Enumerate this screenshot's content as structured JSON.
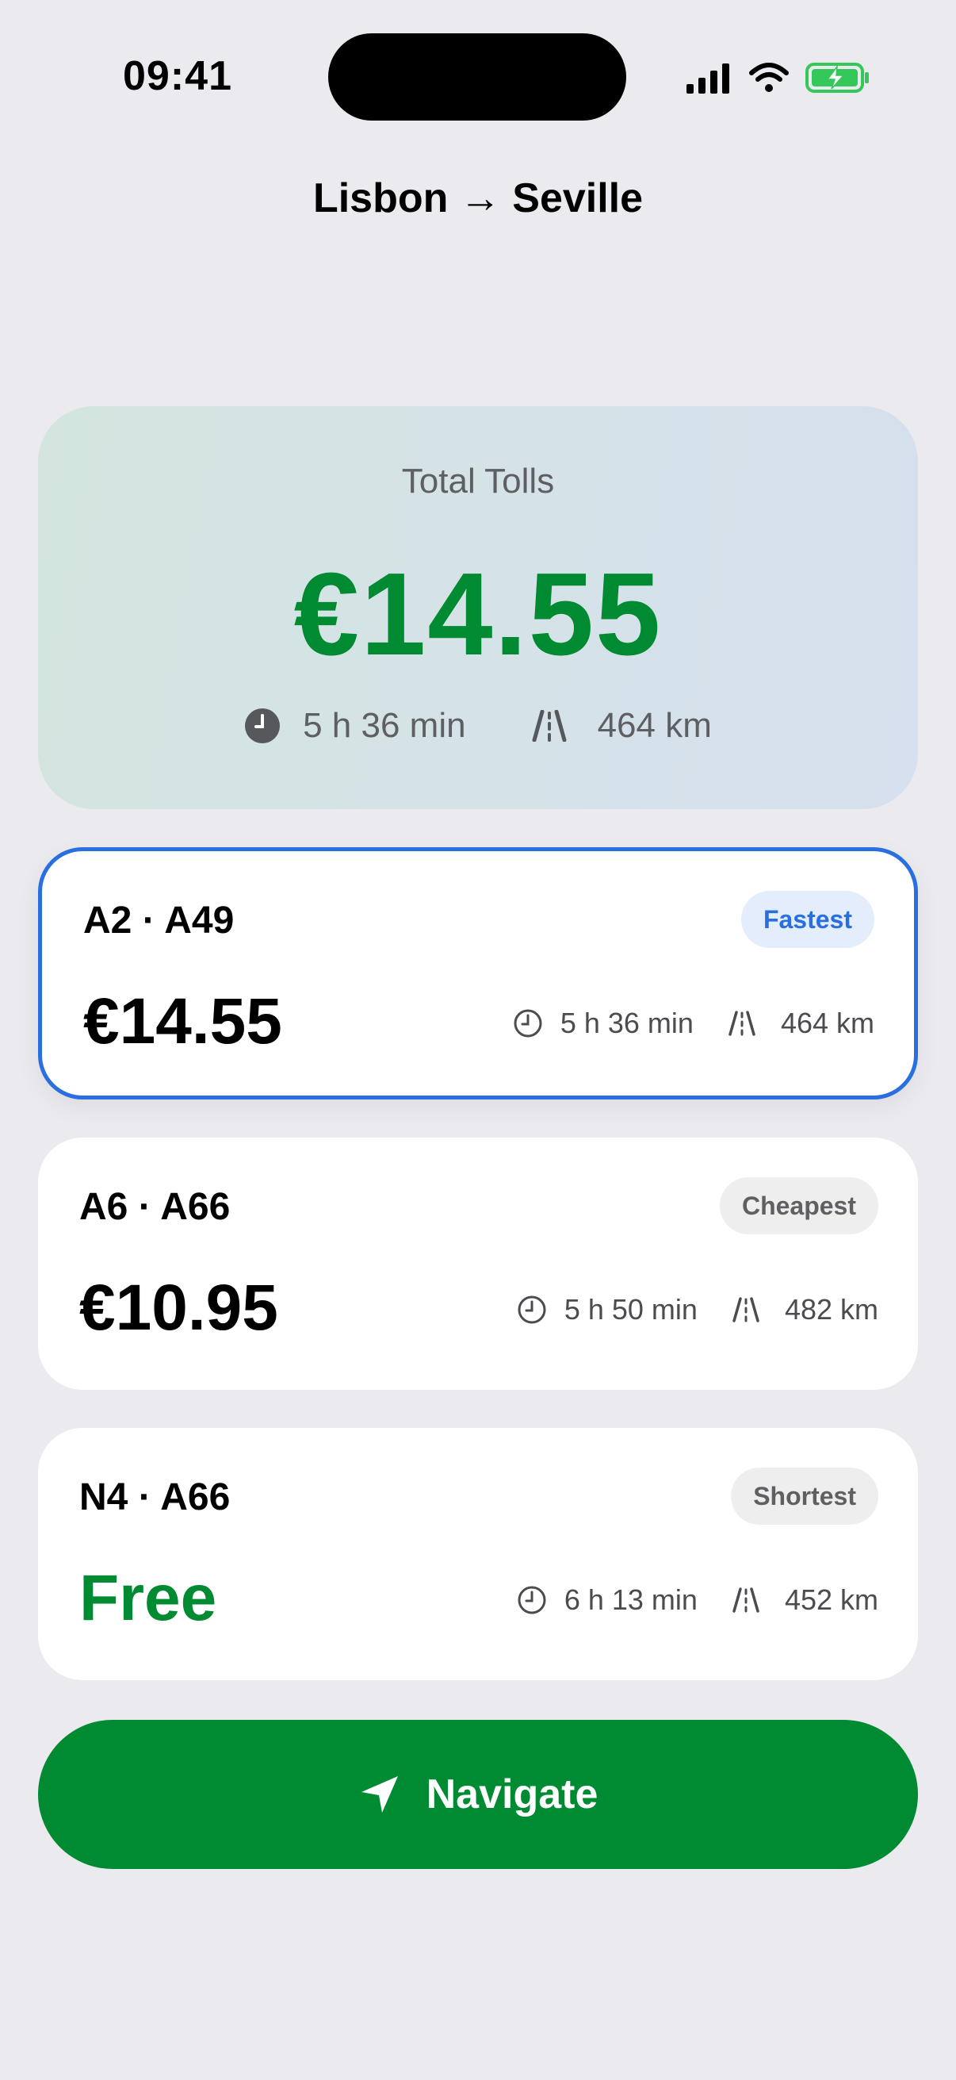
{
  "status_bar": {
    "time": "09:41",
    "icons": [
      "signal-icon",
      "wifi-icon",
      "battery-charging-icon"
    ],
    "battery_color": "#34c759"
  },
  "header": {
    "title": "Lisbon → Seville"
  },
  "summary": {
    "label": "Total Tolls",
    "amount": "€14.55",
    "duration": "5 h 36 min",
    "distance": "464 km",
    "accent_color": "#008a32"
  },
  "routes": [
    {
      "name": "A2 · A49",
      "badge": "Fastest",
      "price": "€14.55",
      "duration": "5 h 36 min",
      "distance": "464 km",
      "selected": true
    },
    {
      "name": "A6 · A66",
      "badge": "Cheapest",
      "price": "€10.95",
      "duration": "5 h 50 min",
      "distance": "482 km",
      "selected": false
    },
    {
      "name": "N4 · A66",
      "badge": "Shortest",
      "price": "Free",
      "duration": "6 h 13 min",
      "distance": "452 km",
      "selected": false
    }
  ],
  "navigate_button": {
    "label": "Navigate",
    "color": "#008a32"
  },
  "colors": {
    "selected_border": "#2a6fe0",
    "background": "#ebeaef"
  }
}
